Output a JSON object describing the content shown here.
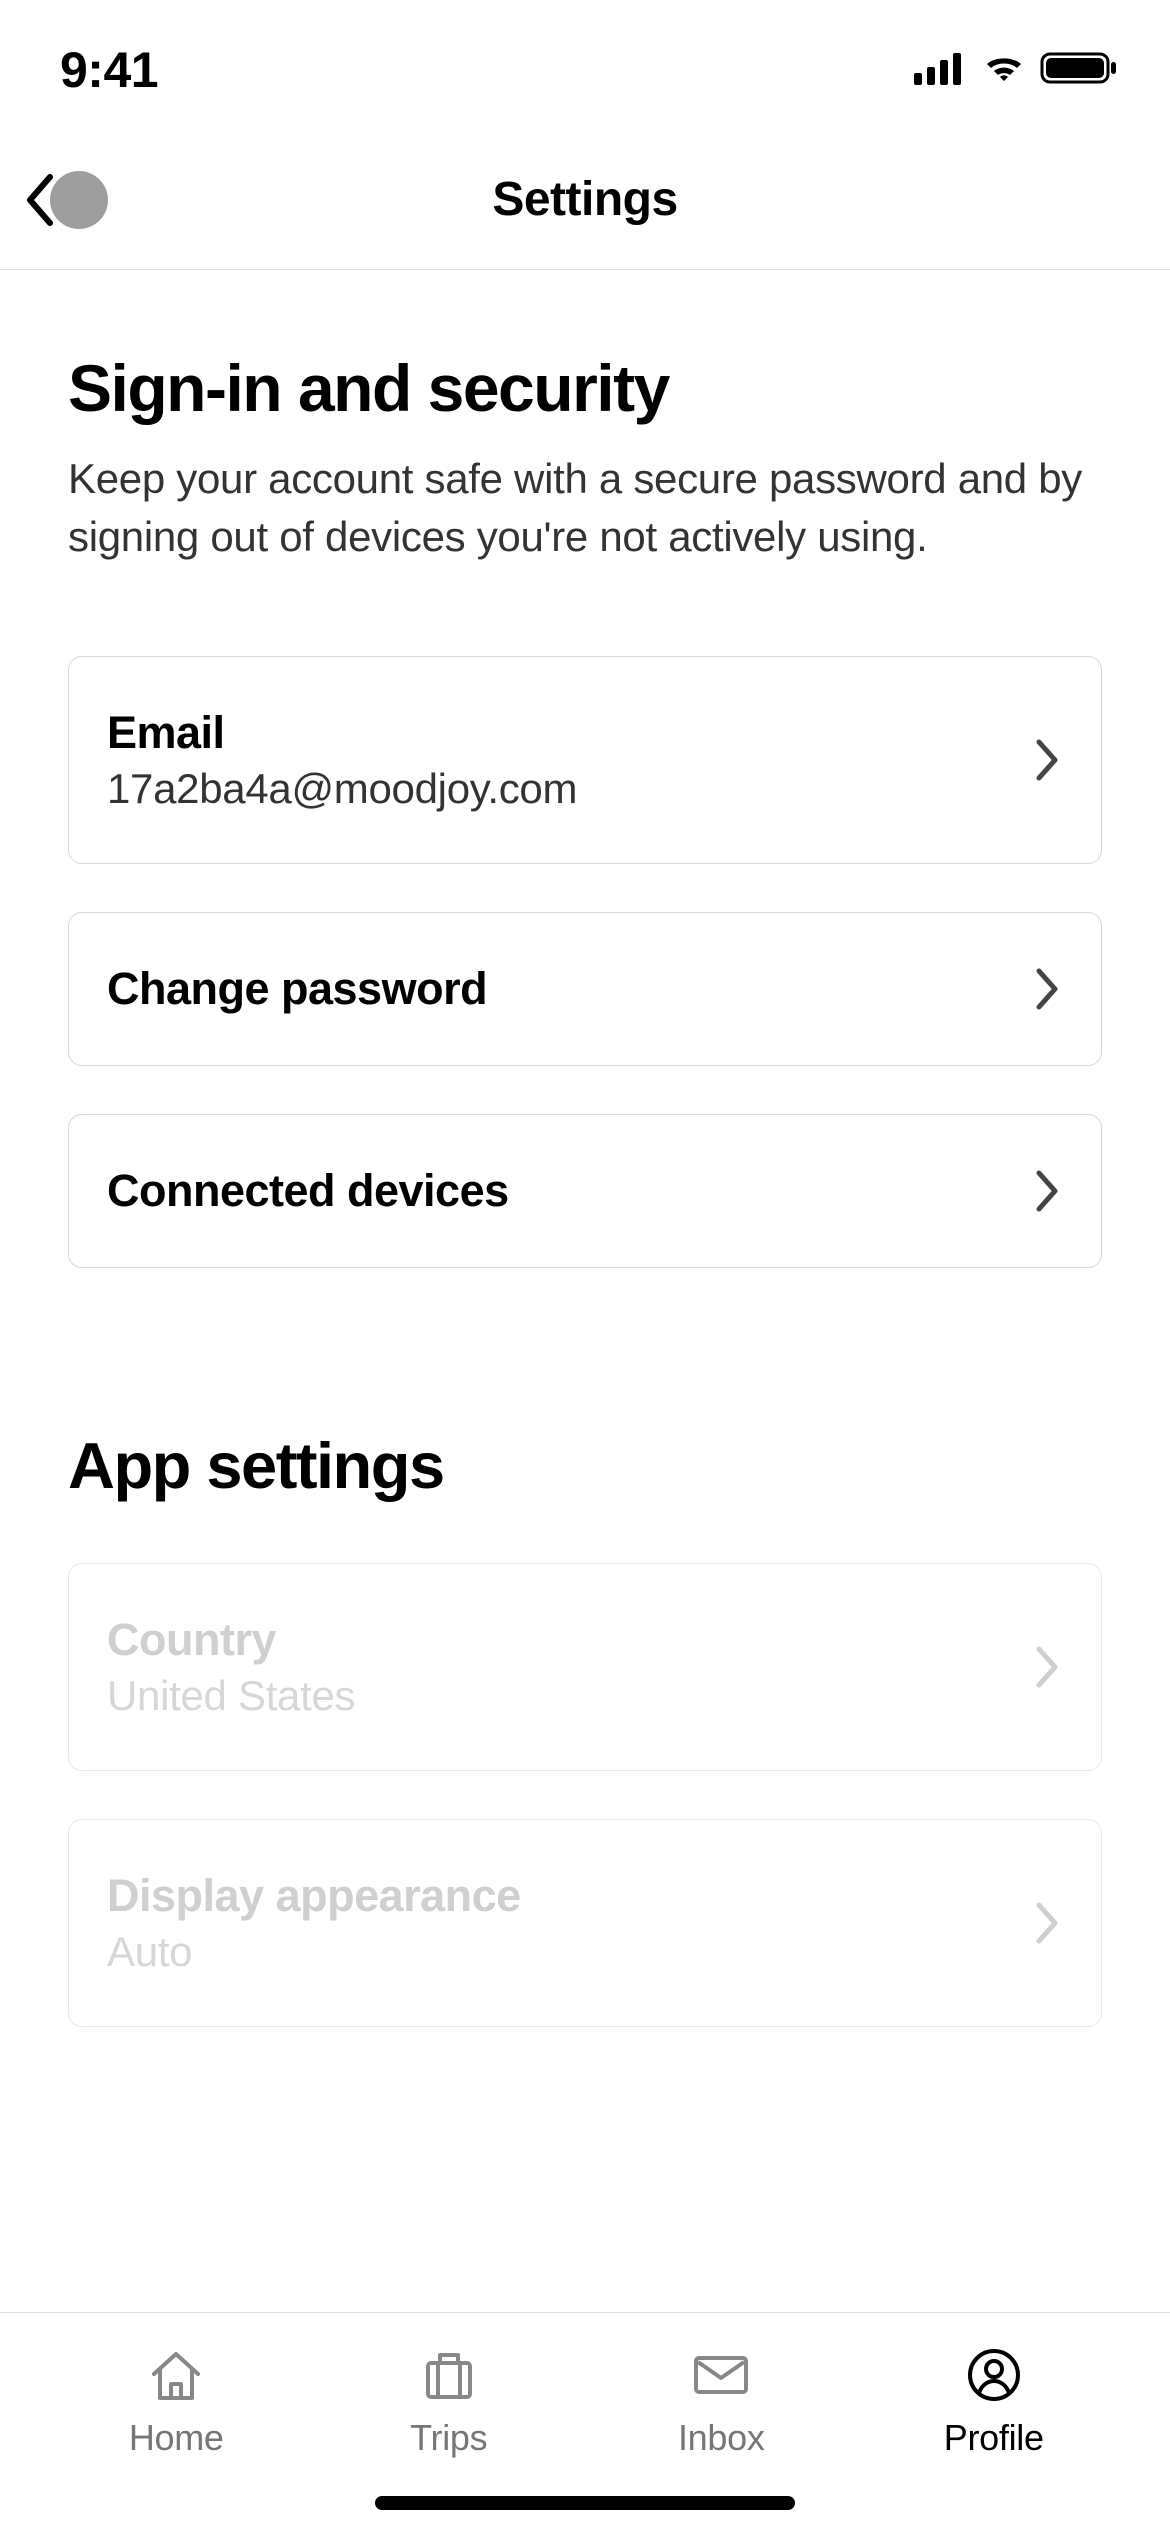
{
  "status": {
    "time": "9:41"
  },
  "header": {
    "title": "Settings"
  },
  "section1": {
    "title": "Sign-in and security",
    "description": "Keep your account safe with a secure password and by signing out of devices you're not actively using."
  },
  "options": [
    {
      "label": "Email",
      "value": "17a2ba4a@moodjoy.com"
    },
    {
      "label": "Change password"
    },
    {
      "label": "Connected devices"
    }
  ],
  "section2": {
    "title": "App settings"
  },
  "appOptions": [
    {
      "label": "Country",
      "value": "United States"
    },
    {
      "label": "Display appearance",
      "value": "Auto"
    }
  ],
  "tabs": {
    "home": "Home",
    "trips": "Trips",
    "inbox": "Inbox",
    "profile": "Profile"
  }
}
